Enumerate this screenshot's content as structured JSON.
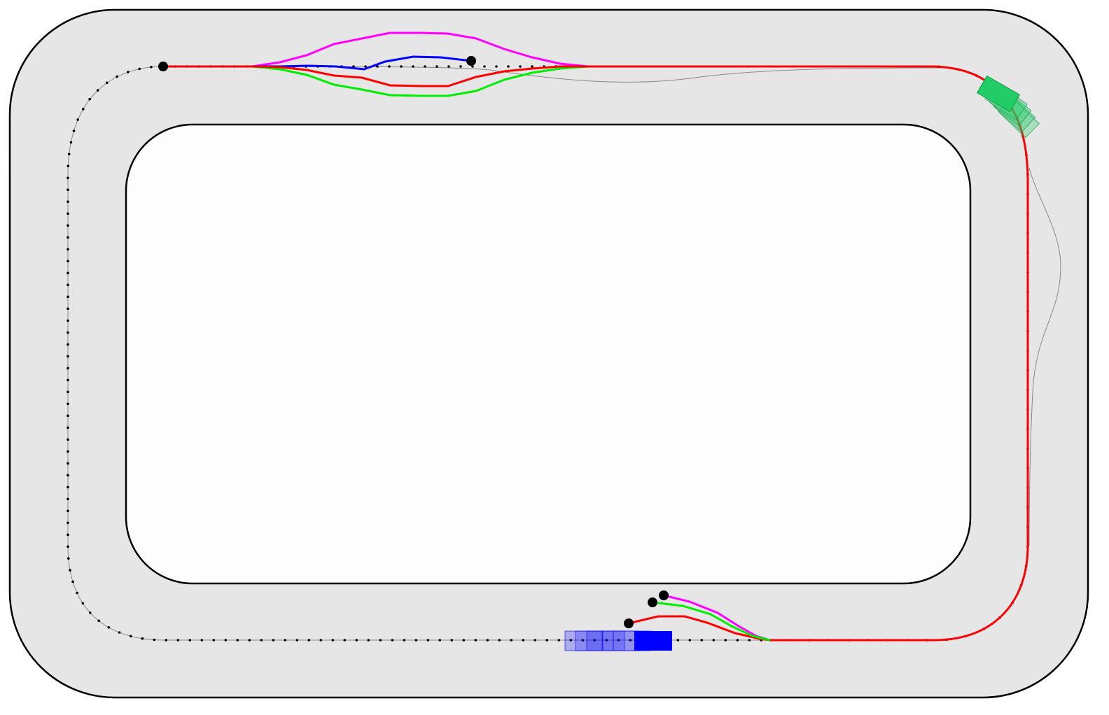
{
  "scene": {
    "colors": {
      "road": "#e6e6e6",
      "infield": "#fdfdfd",
      "border": "#000000",
      "reference_path": "#888888",
      "waypoint": "#000000",
      "trajectory_magenta": "#ff00ff",
      "trajectory_blue": "#0000ff",
      "trajectory_green": "#00ee00",
      "trajectory_red": "#ff0000",
      "ego_vehicle": "#0000ff",
      "other_vehicle": "#22cc66"
    },
    "vehicles": [
      {
        "id": "ego",
        "color": "#0000ff",
        "ghost_trail": true
      },
      {
        "id": "other",
        "color": "#22cc66",
        "ghost_trail": true
      }
    ],
    "trajectories": [
      {
        "name": "magenta",
        "color": "#ff00ff"
      },
      {
        "name": "blue",
        "color": "#0000ff"
      },
      {
        "name": "green",
        "color": "#00ee00"
      },
      {
        "name": "red",
        "color": "#ff0000"
      }
    ]
  }
}
